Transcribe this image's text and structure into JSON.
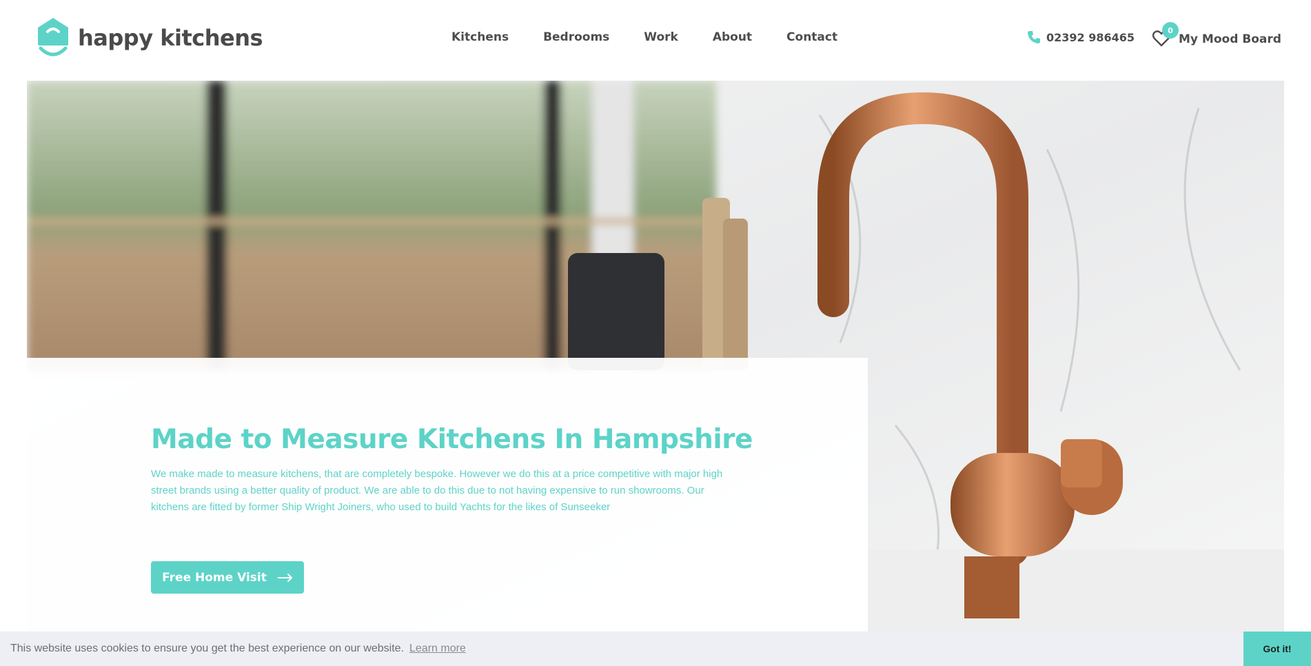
{
  "brand": {
    "name": "happy kitchens",
    "accent": "#5dd3c8"
  },
  "nav": {
    "items": [
      {
        "label": "Kitchens"
      },
      {
        "label": "Bedrooms"
      },
      {
        "label": "Work"
      },
      {
        "label": "About"
      },
      {
        "label": "Contact"
      }
    ]
  },
  "header": {
    "phone": "02392 986465",
    "moodboard_label": "My Mood Board",
    "moodboard_count": "0"
  },
  "hero": {
    "title": "Made to Measure Kitchens In Hampshire",
    "description": "We make made to measure kitchens, that are completely bespoke. However we do this at a price competitive with major high street brands using a better quality of product. We are able to do this due to not having expensive to run showrooms. Our kitchens are fitted by former Ship Wright Joiners, who used to build Yachts for the likes of Sunseeker",
    "cta_label": "Free Home Visit"
  },
  "cookie": {
    "message": "This website uses cookies to ensure you get the best experience on our website.",
    "link_label": "Learn more",
    "button_label": "Got it!"
  }
}
